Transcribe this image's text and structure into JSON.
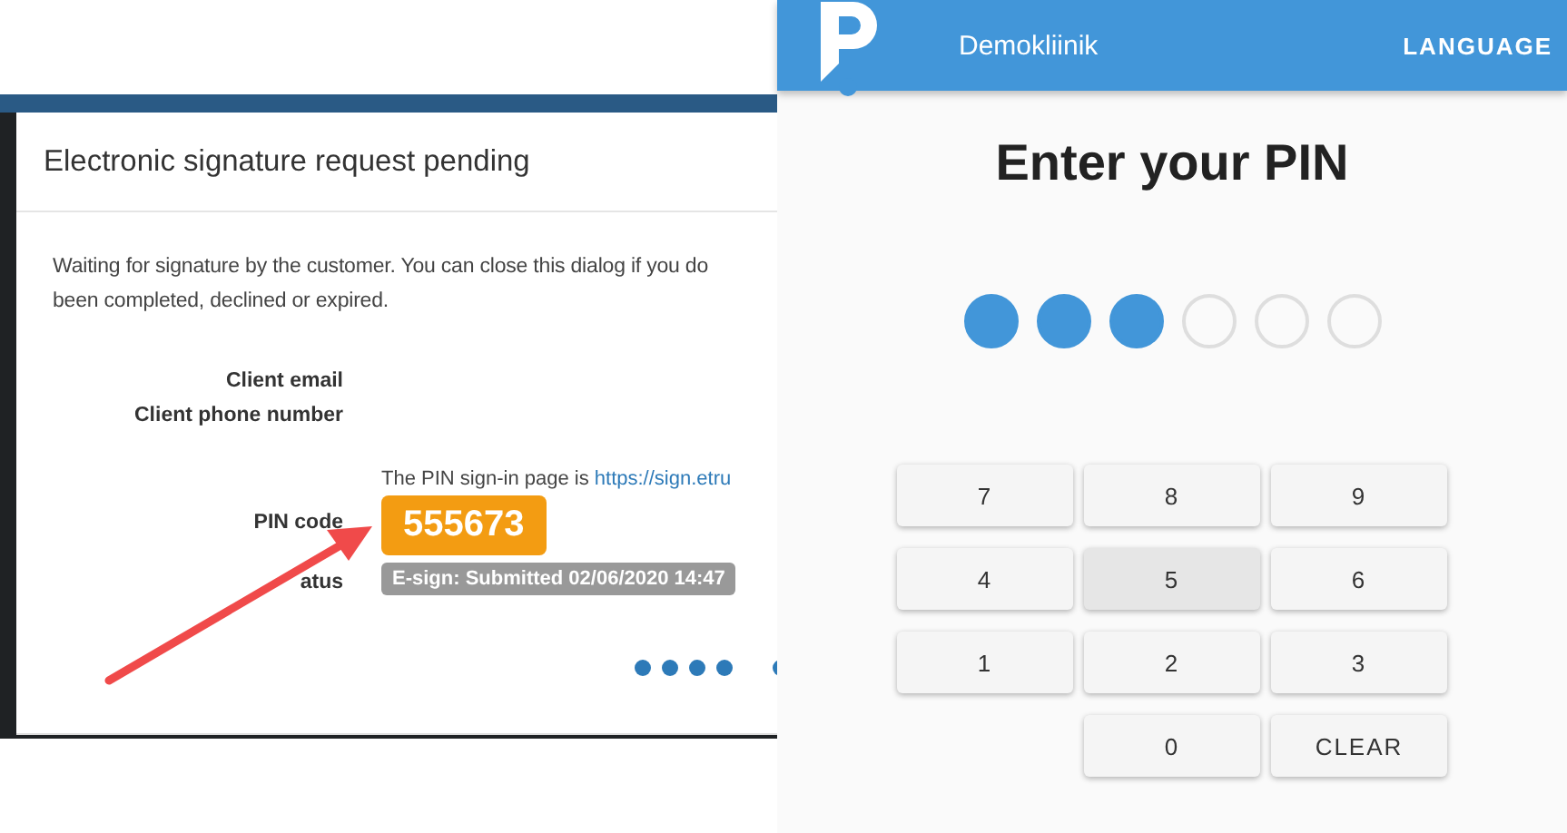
{
  "dialog": {
    "title": "Electronic signature request pending",
    "description_lines": [
      "Waiting for signature by the customer. You can close this dialog if you do",
      "been completed, declined or expired."
    ],
    "fields": [
      {
        "kind": "plain",
        "label": "Client email"
      },
      {
        "kind": "plain",
        "label": "Client phone number"
      },
      {
        "kind": "pin",
        "label": "PIN code",
        "note": "The PIN sign-in page is ",
        "link": "https://sign.etru",
        "value": "555673"
      },
      {
        "kind": "status",
        "label": "atus",
        "value": "E-sign: Submitted 02/06/2020 14:47"
      }
    ]
  },
  "pin_page": {
    "app_name": "Demokliinik",
    "language_button": "LANGUAGE",
    "title": "Enter your PIN",
    "pin_dots": [
      {
        "filled": true
      },
      {
        "filled": true
      },
      {
        "filled": true
      },
      {
        "filled": false
      },
      {
        "filled": false
      },
      {
        "filled": false
      }
    ],
    "keys": [
      {
        "kind": "digit",
        "label": "7",
        "pressed": false
      },
      {
        "kind": "digit",
        "label": "8",
        "pressed": false
      },
      {
        "kind": "digit",
        "label": "9",
        "pressed": false
      },
      {
        "kind": "digit",
        "label": "4",
        "pressed": false
      },
      {
        "kind": "digit",
        "label": "5",
        "pressed": true
      },
      {
        "kind": "digit",
        "label": "6",
        "pressed": false
      },
      {
        "kind": "digit",
        "label": "1",
        "pressed": false
      },
      {
        "kind": "digit",
        "label": "2",
        "pressed": false
      },
      {
        "kind": "digit",
        "label": "3",
        "pressed": false
      },
      {
        "kind": "blank"
      },
      {
        "kind": "digit",
        "label": "0",
        "pressed": false
      },
      {
        "kind": "action",
        "label": "CLEAR",
        "pressed": false
      }
    ]
  }
}
